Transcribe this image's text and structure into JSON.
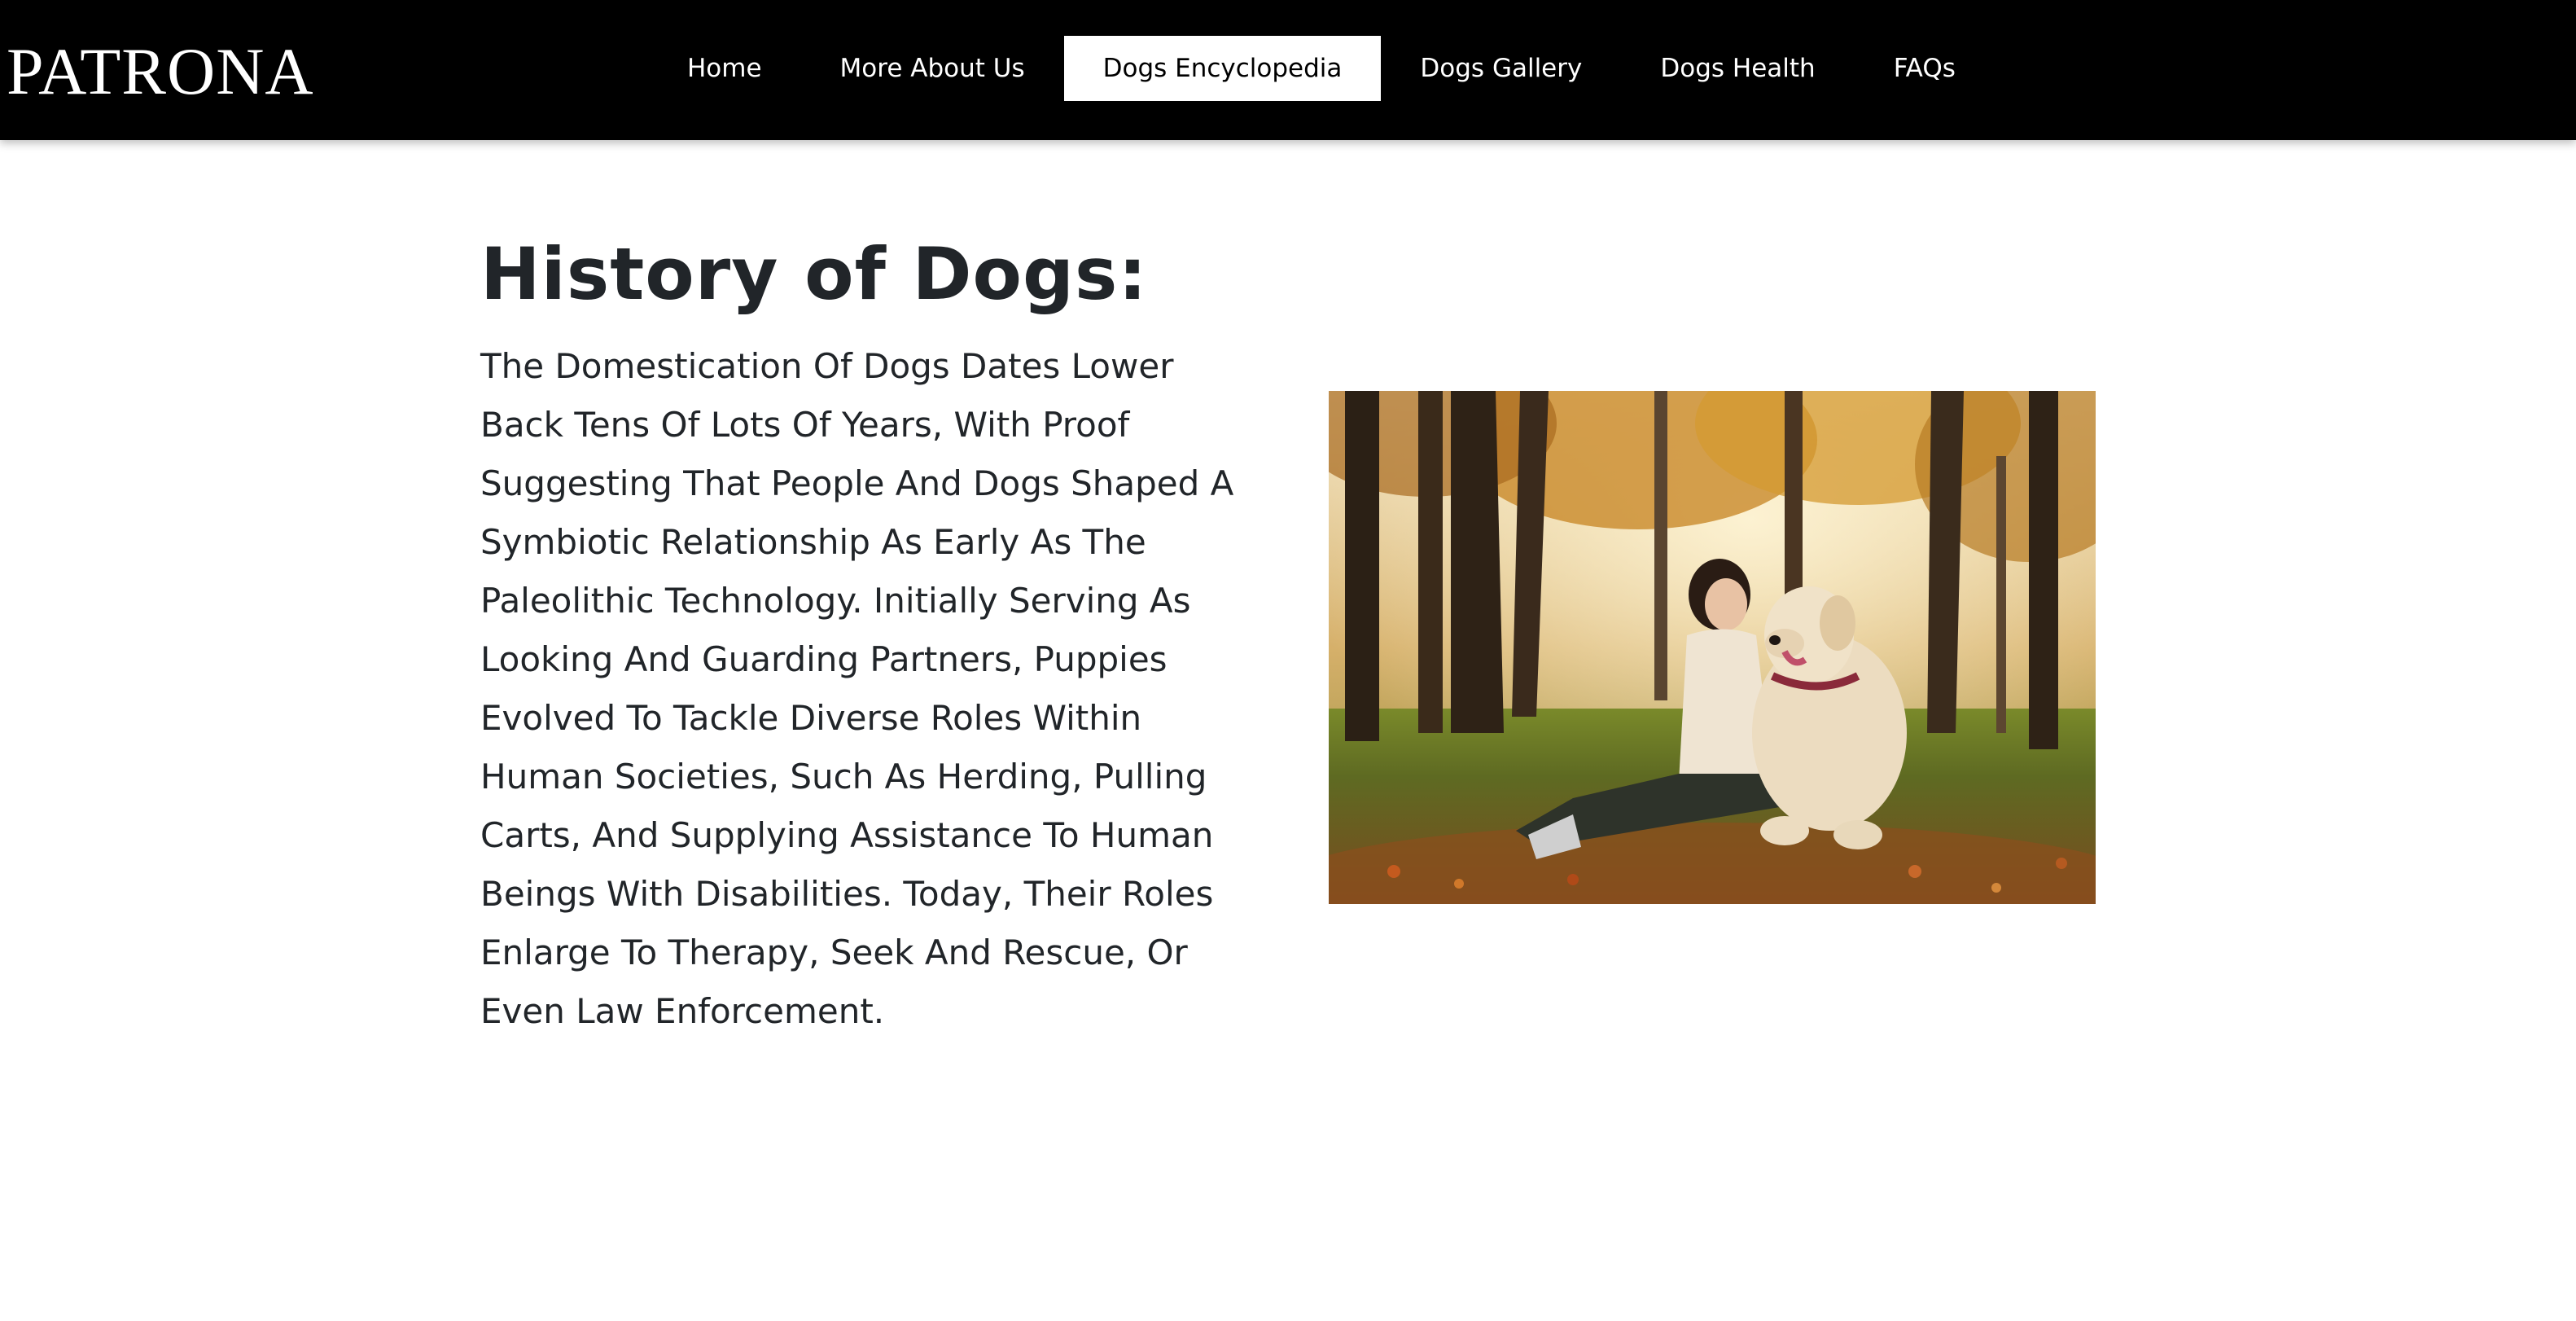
{
  "brand": {
    "name": "PATRONA"
  },
  "nav": {
    "items": [
      {
        "label": "Home"
      },
      {
        "label": "More About Us"
      },
      {
        "label": "Dogs Encyclopedia",
        "active": true
      },
      {
        "label": "Dogs Gallery"
      },
      {
        "label": "Dogs Health"
      },
      {
        "label": "FAQs"
      }
    ]
  },
  "content": {
    "title": "History of Dogs:",
    "body": "The Domestication Of Dogs Dates Lower Back Tens Of Lots Of Years, With Proof Suggesting That People And Dogs Shaped A Symbiotic Relationship As Early As The Paleolithic Technology. Initially Serving As Looking And Guarding Partners, Puppies Evolved To Tackle Diverse Roles Within Human Societies, Such As Herding, Pulling Carts, And Supplying Assistance To Human Beings With Disabilities. Today, Their Roles Enlarge To Therapy, Seek And Rescue, Or Even Law Enforcement.",
    "image_subject": "woman-with-golden-retriever-in-autumn-park"
  },
  "colors": {
    "navbar_bg": "#000000",
    "nav_active_bg": "#ffffff",
    "text": "#212529"
  }
}
